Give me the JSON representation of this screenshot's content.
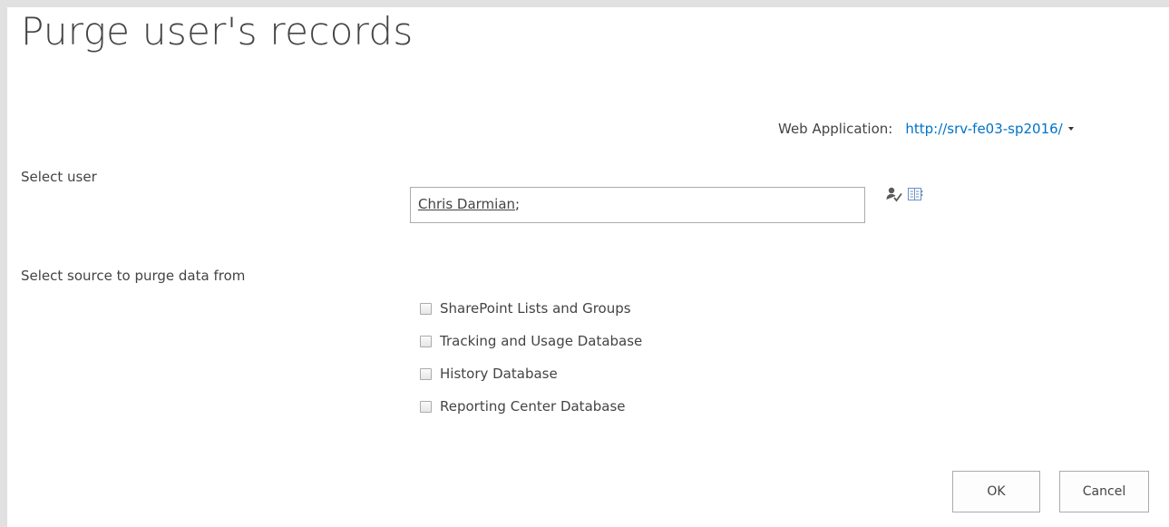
{
  "page": {
    "title": "Purge user's records"
  },
  "web_application": {
    "label": "Web Application:",
    "value": "http://srv-fe03-sp2016/"
  },
  "select_user": {
    "label": "Select user",
    "value": "Chris Darmian",
    "separator": ";",
    "icons": [
      "check-names-icon",
      "browse-address-book-icon"
    ]
  },
  "purge_sources": {
    "label": "Select source to purge data from",
    "options": [
      {
        "label": "SharePoint Lists and Groups",
        "checked": false
      },
      {
        "label": "Tracking and Usage Database",
        "checked": false
      },
      {
        "label": "History Database",
        "checked": false
      },
      {
        "label": "Reporting Center Database",
        "checked": false
      }
    ]
  },
  "buttons": {
    "ok": "OK",
    "cancel": "Cancel"
  },
  "colors": {
    "link": "#0072c6",
    "frame": "#e1e1e1",
    "text": "#444444"
  }
}
